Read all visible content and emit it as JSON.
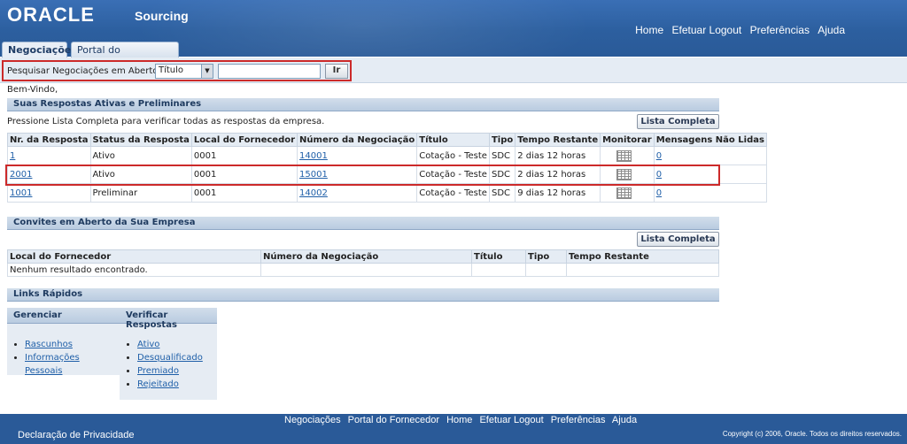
{
  "header": {
    "logo": "ORACLE",
    "app_name": "Sourcing",
    "global_links": [
      "Home",
      "Efetuar Logout",
      "Preferências",
      "Ajuda"
    ]
  },
  "tabs": [
    {
      "label": "Negociações",
      "active": true
    },
    {
      "label": "Portal do Fornecedor",
      "active": false
    }
  ],
  "search": {
    "label": "Pesquisar Negociações em Aberto",
    "select_value": "Título",
    "input_value": "",
    "go_label": "Ir"
  },
  "welcome": "Bem-Vindo,",
  "responses": {
    "title": "Suas Respostas Ativas e Preliminares",
    "instruction": "Pressione Lista Completa para verificar todas as respostas da empresa.",
    "full_list_button": "Lista Completa",
    "columns": [
      "Nr. da Resposta",
      "Status da Resposta",
      "Local do Fornecedor",
      "Número da Negociação",
      "Título",
      "Tipo",
      "Tempo Restante",
      "Monitorar",
      "Mensagens Não Lidas"
    ],
    "rows": [
      {
        "response": "1",
        "status": "Ativo",
        "site": "0001",
        "negotiation": "14001",
        "title": "Cotação - Teste",
        "type": "SDC",
        "remaining": "2 dias 12 horas",
        "unread": "0"
      },
      {
        "response": "2001",
        "status": "Ativo",
        "site": "0001",
        "negotiation": "15001",
        "title": "Cotação - Teste",
        "type": "SDC",
        "remaining": "2 dias 12 horas",
        "unread": "0"
      },
      {
        "response": "1001",
        "status": "Preliminar",
        "site": "0001",
        "negotiation": "14002",
        "title": "Cotação - Teste",
        "type": "SDC",
        "remaining": "9 dias 12 horas",
        "unread": "0"
      }
    ]
  },
  "invitations": {
    "title": "Convites em Aberto da Sua Empresa",
    "full_list_button": "Lista Completa",
    "columns": [
      "Local do Fornecedor",
      "Número da Negociação",
      "Título",
      "Tipo",
      "Tempo Restante"
    ],
    "empty_message": "Nenhum resultado encontrado."
  },
  "quick_links": {
    "title": "Links Rápidos",
    "manage": {
      "title": "Gerenciar",
      "items": [
        "Rascunhos",
        "Informações Pessoais"
      ]
    },
    "check_responses": {
      "title": "Verificar Respostas",
      "items": [
        "Ativo",
        "Desqualificado",
        "Premiado",
        "Rejeitado"
      ]
    }
  },
  "footer": {
    "links": [
      "Negociações",
      "Portal do Fornecedor",
      "Home",
      "Efetuar Logout",
      "Preferências",
      "Ajuda"
    ],
    "privacy": "Declaração de Privacidade",
    "copyright": "Copyright (c) 2006, Oracle. Todos os direitos reservados."
  },
  "colors": {
    "header_blue": "#2c5f9f",
    "highlight_red": "#cc2a2a",
    "link_blue": "#1f5fa8"
  }
}
